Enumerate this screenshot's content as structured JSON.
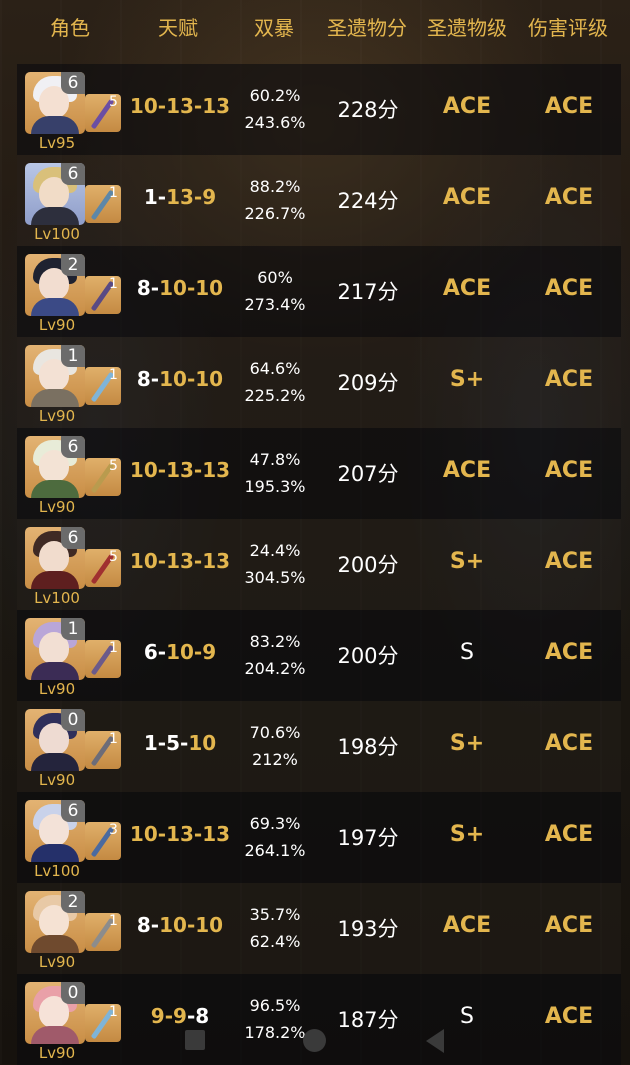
{
  "header": {
    "col_role": "角色",
    "col_talent": "天赋",
    "col_crit": "双暴",
    "col_score": "圣遗物分",
    "col_artifact_grade": "圣遗物级",
    "col_damage_grade": "伤害评级"
  },
  "colors": {
    "gold": "#e3b64e",
    "white": "#ffffff"
  },
  "rows": [
    {
      "constellation": "6",
      "refinement": "5",
      "level": "Lv95",
      "talent": [
        {
          "v": "10",
          "c": "gold"
        },
        {
          "v": "-",
          "c": "gold"
        },
        {
          "v": "13",
          "c": "gold"
        },
        {
          "v": "-",
          "c": "gold"
        },
        {
          "v": "13",
          "c": "gold"
        }
      ],
      "crit_rate": "60.2%",
      "crit_dmg": "243.6%",
      "score": "228分",
      "artifact_grade": "ACE",
      "damage_grade": "ACE",
      "avatar_icon": "character-white-hair-icon",
      "weapon_icon": "sword-weapon-icon"
    },
    {
      "constellation": "6",
      "refinement": "1",
      "level": "Lv100",
      "talent": [
        {
          "v": "1",
          "c": "white"
        },
        {
          "v": "-",
          "c": "white"
        },
        {
          "v": "13",
          "c": "gold"
        },
        {
          "v": "-",
          "c": "gold"
        },
        {
          "v": "9",
          "c": "gold"
        }
      ],
      "crit_rate": "88.2%",
      "crit_dmg": "226.7%",
      "score": "224分",
      "artifact_grade": "ACE",
      "damage_grade": "ACE",
      "avatar_icon": "character-blond-hair-icon",
      "weapon_icon": "sword-weapon-icon"
    },
    {
      "constellation": "2",
      "refinement": "1",
      "level": "Lv90",
      "talent": [
        {
          "v": "8",
          "c": "white"
        },
        {
          "v": "-",
          "c": "white"
        },
        {
          "v": "10",
          "c": "gold"
        },
        {
          "v": "-",
          "c": "gold"
        },
        {
          "v": "10",
          "c": "gold"
        }
      ],
      "crit_rate": "60%",
      "crit_dmg": "273.4%",
      "score": "217分",
      "artifact_grade": "ACE",
      "damage_grade": "ACE",
      "avatar_icon": "character-dark-hair-icon",
      "weapon_icon": "polearm-weapon-icon"
    },
    {
      "constellation": "1",
      "refinement": "1",
      "level": "Lv90",
      "talent": [
        {
          "v": "8",
          "c": "white"
        },
        {
          "v": "-",
          "c": "white"
        },
        {
          "v": "10",
          "c": "gold"
        },
        {
          "v": "-",
          "c": "gold"
        },
        {
          "v": "10",
          "c": "gold"
        }
      ],
      "crit_rate": "64.6%",
      "crit_dmg": "225.2%",
      "score": "209分",
      "artifact_grade": "S+",
      "damage_grade": "ACE",
      "avatar_icon": "character-silver-hair-icon",
      "weapon_icon": "catalyst-weapon-icon"
    },
    {
      "constellation": "6",
      "refinement": "5",
      "level": "Lv90",
      "talent": [
        {
          "v": "10",
          "c": "gold"
        },
        {
          "v": "-",
          "c": "gold"
        },
        {
          "v": "13",
          "c": "gold"
        },
        {
          "v": "-",
          "c": "gold"
        },
        {
          "v": "13",
          "c": "gold"
        }
      ],
      "crit_rate": "47.8%",
      "crit_dmg": "195.3%",
      "score": "207分",
      "artifact_grade": "ACE",
      "damage_grade": "ACE",
      "avatar_icon": "character-green-hair-icon",
      "weapon_icon": "lamp-catalyst-icon"
    },
    {
      "constellation": "6",
      "refinement": "5",
      "level": "Lv100",
      "talent": [
        {
          "v": "10",
          "c": "gold"
        },
        {
          "v": "-",
          "c": "gold"
        },
        {
          "v": "13",
          "c": "gold"
        },
        {
          "v": "-",
          "c": "gold"
        },
        {
          "v": "13",
          "c": "gold"
        }
      ],
      "crit_rate": "24.4%",
      "crit_dmg": "304.5%",
      "score": "200分",
      "artifact_grade": "S+",
      "damage_grade": "ACE",
      "avatar_icon": "character-hat-icon",
      "weapon_icon": "red-polearm-weapon-icon"
    },
    {
      "constellation": "1",
      "refinement": "1",
      "level": "Lv90",
      "talent": [
        {
          "v": "6",
          "c": "white"
        },
        {
          "v": "-",
          "c": "white"
        },
        {
          "v": "10",
          "c": "gold"
        },
        {
          "v": "-",
          "c": "gold"
        },
        {
          "v": "9",
          "c": "gold"
        }
      ],
      "crit_rate": "83.2%",
      "crit_dmg": "204.2%",
      "score": "200分",
      "artifact_grade": "S",
      "damage_grade": "ACE",
      "avatar_icon": "character-lavender-hair-icon",
      "weapon_icon": "polearm-weapon-icon"
    },
    {
      "constellation": "0",
      "refinement": "1",
      "level": "Lv90",
      "talent": [
        {
          "v": "1",
          "c": "white"
        },
        {
          "v": "-",
          "c": "white"
        },
        {
          "v": "5",
          "c": "white"
        },
        {
          "v": "-",
          "c": "white"
        },
        {
          "v": "10",
          "c": "gold"
        }
      ],
      "crit_rate": "70.6%",
      "crit_dmg": "212%",
      "score": "198分",
      "artifact_grade": "S+",
      "damage_grade": "ACE",
      "avatar_icon": "character-blue-hair-icon",
      "weapon_icon": "sword-weapon-icon"
    },
    {
      "constellation": "6",
      "refinement": "3",
      "level": "Lv100",
      "talent": [
        {
          "v": "10",
          "c": "gold"
        },
        {
          "v": "-",
          "c": "gold"
        },
        {
          "v": "13",
          "c": "gold"
        },
        {
          "v": "-",
          "c": "gold"
        },
        {
          "v": "13",
          "c": "gold"
        }
      ],
      "crit_rate": "69.3%",
      "crit_dmg": "264.1%",
      "score": "197分",
      "artifact_grade": "S+",
      "damage_grade": "ACE",
      "avatar_icon": "character-white-blue-hair-icon",
      "weapon_icon": "sword-weapon-icon"
    },
    {
      "constellation": "2",
      "refinement": "1",
      "level": "Lv90",
      "talent": [
        {
          "v": "8",
          "c": "white"
        },
        {
          "v": "-",
          "c": "white"
        },
        {
          "v": "10",
          "c": "gold"
        },
        {
          "v": "-",
          "c": "gold"
        },
        {
          "v": "10",
          "c": "gold"
        }
      ],
      "crit_rate": "35.7%",
      "crit_dmg": "62.4%",
      "score": "193分",
      "artifact_grade": "ACE",
      "damage_grade": "ACE",
      "avatar_icon": "character-ginger-hair-icon",
      "weapon_icon": "sword-weapon-icon"
    },
    {
      "constellation": "0",
      "refinement": "1",
      "level": "Lv90",
      "talent": [
        {
          "v": "9",
          "c": "gold"
        },
        {
          "v": "-",
          "c": "gold"
        },
        {
          "v": "9",
          "c": "gold"
        },
        {
          "v": "-",
          "c": "white"
        },
        {
          "v": "8",
          "c": "white"
        }
      ],
      "crit_rate": "96.5%",
      "crit_dmg": "178.2%",
      "score": "187分",
      "artifact_grade": "S",
      "damage_grade": "ACE",
      "avatar_icon": "character-pink-hair-icon",
      "weapon_icon": "catalyst-weapon-icon"
    }
  ],
  "navbar": {
    "recent_icon": "square-recents-icon",
    "home_icon": "circle-home-icon",
    "back_icon": "triangle-back-icon"
  }
}
